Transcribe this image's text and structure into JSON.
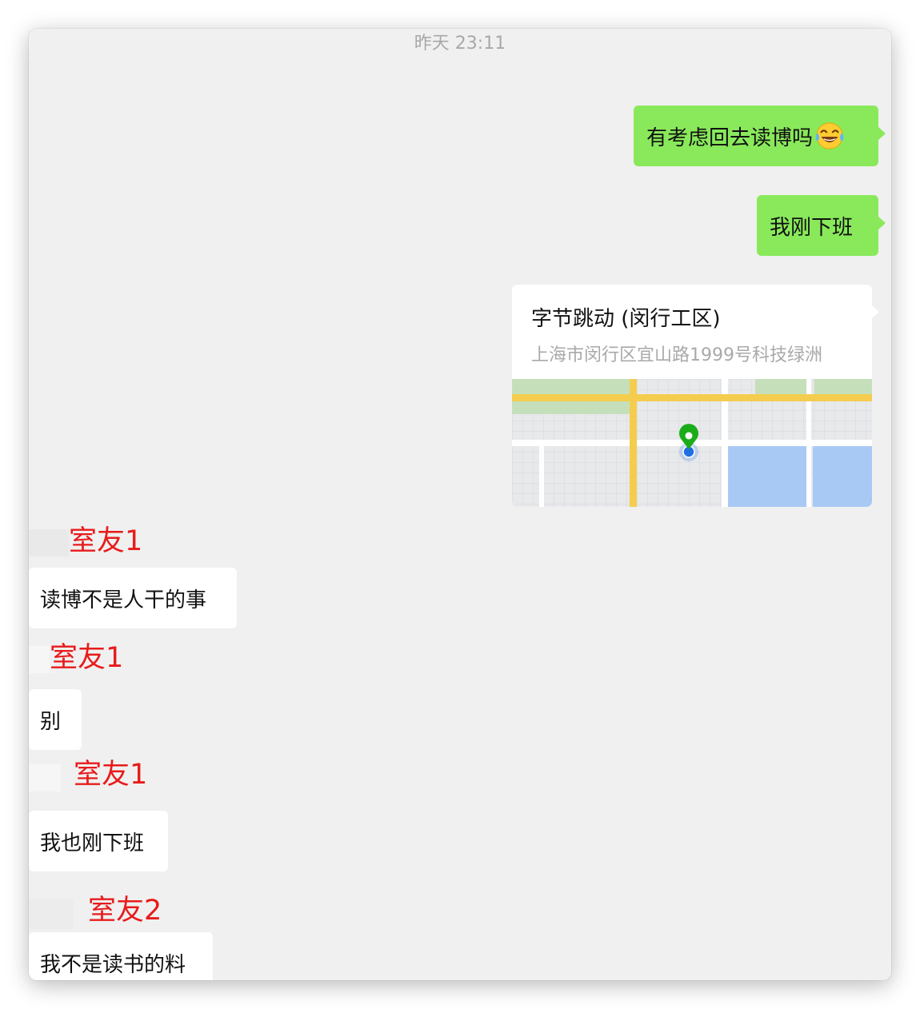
{
  "chat": {
    "timestamp": "昨天 23:11",
    "outgoing": [
      {
        "text": "有考虑回去读博吗",
        "emoji": "laughing-tears-emoji"
      },
      {
        "text": "我刚下班"
      }
    ],
    "location": {
      "name": "字节跳动 (闵行工区)",
      "address": "上海市闵行区宜山路1999号科技绿洲"
    },
    "incoming": [
      {
        "sender": "室友1",
        "text": "读博不是人干的事"
      },
      {
        "sender": "室友1",
        "text": "别"
      },
      {
        "sender": "室友1",
        "text": "我也刚下班"
      },
      {
        "sender": "室友2",
        "text": "我不是读书的料"
      }
    ]
  },
  "colors": {
    "outgoing_bubble": "#89e95b",
    "incoming_bubble": "#ffffff",
    "chat_background": "#f0f0f0",
    "sender_label": "#e81b1b",
    "map_road_yellow": "#f4cd4f",
    "map_park_green": "#c6dfbb",
    "map_water_blue": "#a9c9f5",
    "pin_green": "#1aad19",
    "location_dot_blue": "#1f6fe0"
  }
}
